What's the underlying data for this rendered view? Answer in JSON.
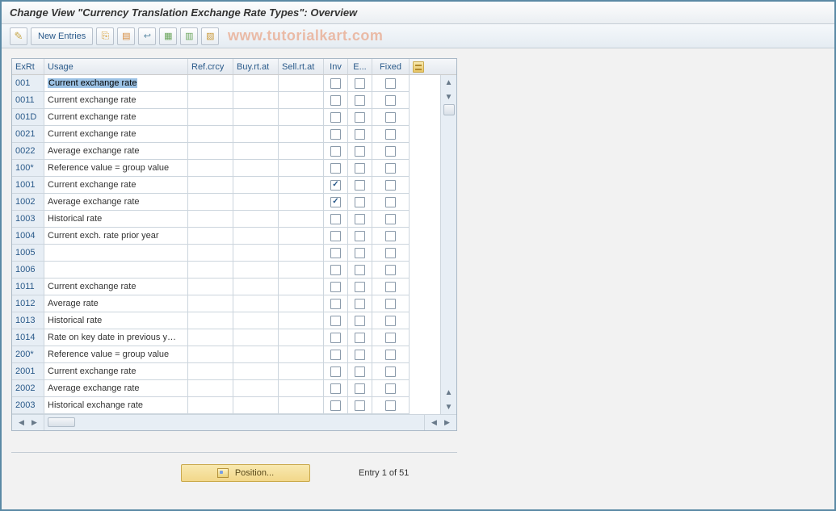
{
  "header": {
    "title": "Change View \"Currency Translation Exchange Rate Types\": Overview"
  },
  "toolbar": {
    "new_entries": "New Entries"
  },
  "watermark": "www.tutorialkart.com",
  "columns": {
    "exrt": "ExRt",
    "usage": "Usage",
    "ref": "Ref.crcy",
    "buy": "Buy.rt.at",
    "sell": "Sell.rt.at",
    "inv": "Inv",
    "e": "E...",
    "fixed": "Fixed"
  },
  "rows": [
    {
      "exrt": "001",
      "usage": "Current exchange rate",
      "ref": "",
      "buy": "",
      "sell": "",
      "inv": false,
      "e": false,
      "fixed": false
    },
    {
      "exrt": "0011",
      "usage": "Current exchange rate",
      "ref": "",
      "buy": "",
      "sell": "",
      "inv": false,
      "e": false,
      "fixed": false
    },
    {
      "exrt": "001D",
      "usage": "Current exchange rate",
      "ref": "",
      "buy": "",
      "sell": "",
      "inv": false,
      "e": false,
      "fixed": false
    },
    {
      "exrt": "0021",
      "usage": "Current exchange rate",
      "ref": "",
      "buy": "",
      "sell": "",
      "inv": false,
      "e": false,
      "fixed": false
    },
    {
      "exrt": "0022",
      "usage": "Average exchange rate",
      "ref": "",
      "buy": "",
      "sell": "",
      "inv": false,
      "e": false,
      "fixed": false
    },
    {
      "exrt": "100*",
      "usage": "Reference value = group value",
      "ref": "",
      "buy": "",
      "sell": "",
      "inv": false,
      "e": false,
      "fixed": false
    },
    {
      "exrt": "1001",
      "usage": "Current exchange rate",
      "ref": "",
      "buy": "",
      "sell": "",
      "inv": true,
      "e": false,
      "fixed": false
    },
    {
      "exrt": "1002",
      "usage": "Average exchange rate",
      "ref": "",
      "buy": "",
      "sell": "",
      "inv": true,
      "e": false,
      "fixed": false
    },
    {
      "exrt": "1003",
      "usage": "Historical rate",
      "ref": "",
      "buy": "",
      "sell": "",
      "inv": false,
      "e": false,
      "fixed": false
    },
    {
      "exrt": "1004",
      "usage": "Current exch. rate prior year",
      "ref": "",
      "buy": "",
      "sell": "",
      "inv": false,
      "e": false,
      "fixed": false
    },
    {
      "exrt": "1005",
      "usage": "",
      "ref": "",
      "buy": "",
      "sell": "",
      "inv": false,
      "e": false,
      "fixed": false
    },
    {
      "exrt": "1006",
      "usage": "",
      "ref": "",
      "buy": "",
      "sell": "",
      "inv": false,
      "e": false,
      "fixed": false
    },
    {
      "exrt": "1011",
      "usage": "Current exchange rate",
      "ref": "",
      "buy": "",
      "sell": "",
      "inv": false,
      "e": false,
      "fixed": false
    },
    {
      "exrt": "1012",
      "usage": "Average rate",
      "ref": "",
      "buy": "",
      "sell": "",
      "inv": false,
      "e": false,
      "fixed": false
    },
    {
      "exrt": "1013",
      "usage": "Historical rate",
      "ref": "",
      "buy": "",
      "sell": "",
      "inv": false,
      "e": false,
      "fixed": false
    },
    {
      "exrt": "1014",
      "usage": "Rate on key date in previous y…",
      "ref": "",
      "buy": "",
      "sell": "",
      "inv": false,
      "e": false,
      "fixed": false
    },
    {
      "exrt": "200*",
      "usage": "Reference value = group value",
      "ref": "",
      "buy": "",
      "sell": "",
      "inv": false,
      "e": false,
      "fixed": false
    },
    {
      "exrt": "2001",
      "usage": "Current exchange rate",
      "ref": "",
      "buy": "",
      "sell": "",
      "inv": false,
      "e": false,
      "fixed": false
    },
    {
      "exrt": "2002",
      "usage": "Average exchange rate",
      "ref": "",
      "buy": "",
      "sell": "",
      "inv": false,
      "e": false,
      "fixed": false
    },
    {
      "exrt": "2003",
      "usage": "Historical exchange rate",
      "ref": "",
      "buy": "",
      "sell": "",
      "inv": false,
      "e": false,
      "fixed": false
    }
  ],
  "footer": {
    "position_label": "Position...",
    "status": "Entry 1 of 51"
  }
}
